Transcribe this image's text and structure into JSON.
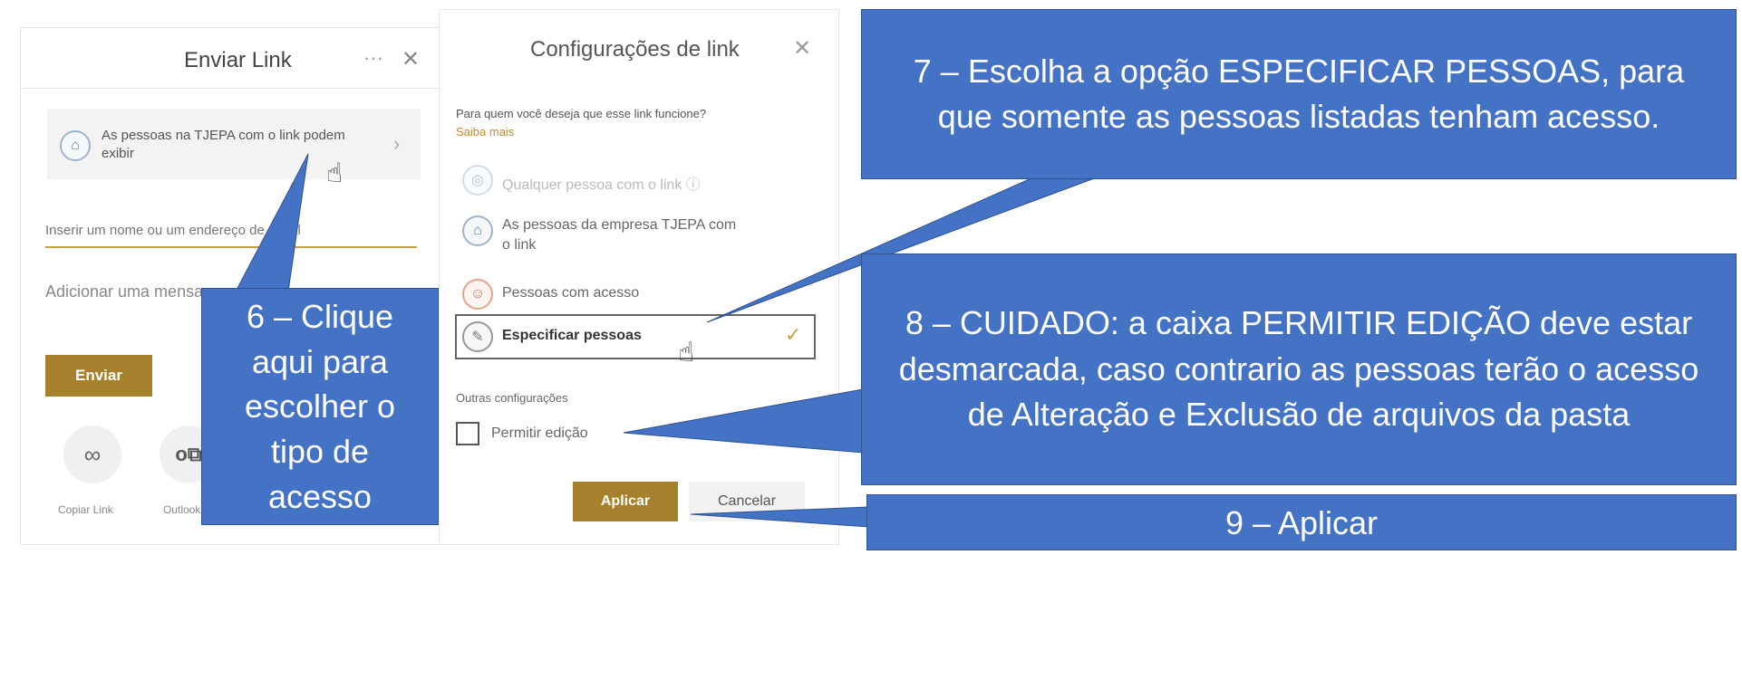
{
  "send_panel": {
    "title": "Enviar Link",
    "more_label": "···",
    "close_label": "✕",
    "link_type_text": "As pessoas na TJEPA com o link podem exibir",
    "recipient_placeholder": "Inserir um nome ou um endereço de email",
    "message_placeholder": "Adicionar uma mensagem",
    "send_button": "Enviar",
    "actions": [
      {
        "label": "Copiar Link",
        "icon": "link-icon"
      },
      {
        "label": "Outlook",
        "icon": "outlook-icon"
      }
    ]
  },
  "settings_panel": {
    "title": "Configurações de link",
    "close_label": "✕",
    "question": "Para quem você deseja que esse link funcione?",
    "learn_more": "Saiba mais",
    "options": [
      {
        "label": "Qualquer pessoa com o link ⓘ",
        "icon": "globe-icon",
        "state": "disabled"
      },
      {
        "label": "As pessoas da empresa TJEPA com o link",
        "icon": "building-icon",
        "state": "normal"
      },
      {
        "label": "Pessoas com acesso",
        "icon": "people-icon",
        "state": "normal"
      },
      {
        "label": "Especificar pessoas",
        "icon": "person-icon",
        "state": "selected"
      }
    ],
    "other_settings": "Outras configurações",
    "allow_edit": {
      "label": "Permitir edição",
      "checked": false
    },
    "apply_button": "Aplicar",
    "cancel_button": "Cancelar"
  },
  "callouts": {
    "step6": "6 – Clique aqui para escolher o tipo de acesso",
    "step7": "7 – Escolha a opção ESPECIFICAR PESSOAS, para que somente as pessoas listadas tenham acesso.",
    "step8": "8 – CUIDADO: a caixa PERMITIR EDIÇÃO deve estar desmarcada, caso contrario as pessoas terão o acesso de Alteração e Exclusão de arquivos da pasta",
    "step9": "9 – Aplicar"
  },
  "colors": {
    "callout_bg": "#4472c4",
    "callout_text": "#ffffff",
    "primary_button": "#a6802c",
    "accent_underline": "#c8a24a",
    "check_mark": "#a6802c"
  }
}
